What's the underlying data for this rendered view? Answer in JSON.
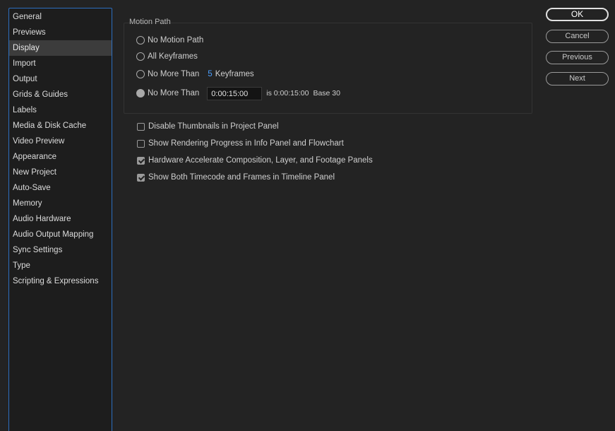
{
  "sidebar": {
    "items": [
      {
        "label": "General",
        "selected": false
      },
      {
        "label": "Previews",
        "selected": false
      },
      {
        "label": "Display",
        "selected": true
      },
      {
        "label": "Import",
        "selected": false
      },
      {
        "label": "Output",
        "selected": false
      },
      {
        "label": "Grids & Guides",
        "selected": false
      },
      {
        "label": "Labels",
        "selected": false
      },
      {
        "label": "Media & Disk Cache",
        "selected": false
      },
      {
        "label": "Video Preview",
        "selected": false
      },
      {
        "label": "Appearance",
        "selected": false
      },
      {
        "label": "New Project",
        "selected": false
      },
      {
        "label": "Auto-Save",
        "selected": false
      },
      {
        "label": "Memory",
        "selected": false
      },
      {
        "label": "Audio Hardware",
        "selected": false
      },
      {
        "label": "Audio Output Mapping",
        "selected": false
      },
      {
        "label": "Sync Settings",
        "selected": false
      },
      {
        "label": "Type",
        "selected": false
      },
      {
        "label": "Scripting & Expressions",
        "selected": false
      }
    ]
  },
  "motion_path": {
    "group_label": "Motion Path",
    "option_no_motion_path": "No Motion Path",
    "option_all_keyframes": "All Keyframes",
    "option_no_more_than_keyframes": "No More Than",
    "keyframes_count": "5",
    "keyframes_unit": "Keyframes",
    "option_no_more_than_time": "No More Than",
    "time_value": "0:00:15:00",
    "time_info": "is 0:00:15:00",
    "time_base": "Base 30",
    "selected_option": "no_more_than_time"
  },
  "checkboxes": {
    "disable_thumbnails": {
      "label": "Disable Thumbnails in Project Panel",
      "checked": false
    },
    "show_rendering_progress": {
      "label": "Show Rendering Progress in Info Panel and Flowchart",
      "checked": false
    },
    "hardware_accelerate": {
      "label": "Hardware Accelerate Composition, Layer, and Footage Panels",
      "checked": true
    },
    "show_timecode_frames": {
      "label": "Show Both Timecode and Frames in Timeline Panel",
      "checked": true
    }
  },
  "buttons": {
    "ok": "OK",
    "cancel": "Cancel",
    "previous": "Previous",
    "next": "Next"
  }
}
